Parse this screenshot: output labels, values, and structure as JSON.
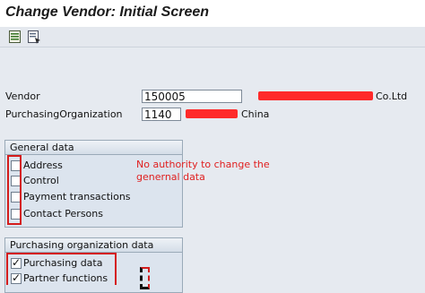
{
  "window": {
    "title": "Change Vendor:  Initial Screen"
  },
  "toolbar": {
    "icons": [
      "select-data-icon",
      "copy-template-icon"
    ]
  },
  "fields": {
    "vendor_label": "Vendor",
    "vendor_value": "150005",
    "vendor_suffix": "Co.Ltd",
    "purch_org_label": "PurchasingOrganization",
    "purch_org_value": "1140",
    "purch_org_suffix": "China"
  },
  "general_data": {
    "title": "General data",
    "items": [
      {
        "label": "Address",
        "checked": false
      },
      {
        "label": "Control",
        "checked": false
      },
      {
        "label": "Payment transactions",
        "checked": false
      },
      {
        "label": "Contact Persons",
        "checked": false
      }
    ],
    "note": "No authority to change the genernal data"
  },
  "purchasing_data": {
    "title": "Purchasing organization data",
    "items": [
      {
        "label": "Purchasing data",
        "checked": true
      },
      {
        "label": "Partner functions",
        "checked": true
      }
    ]
  },
  "colors": {
    "annotation": "#e02020",
    "background": "#e6eaf0"
  }
}
